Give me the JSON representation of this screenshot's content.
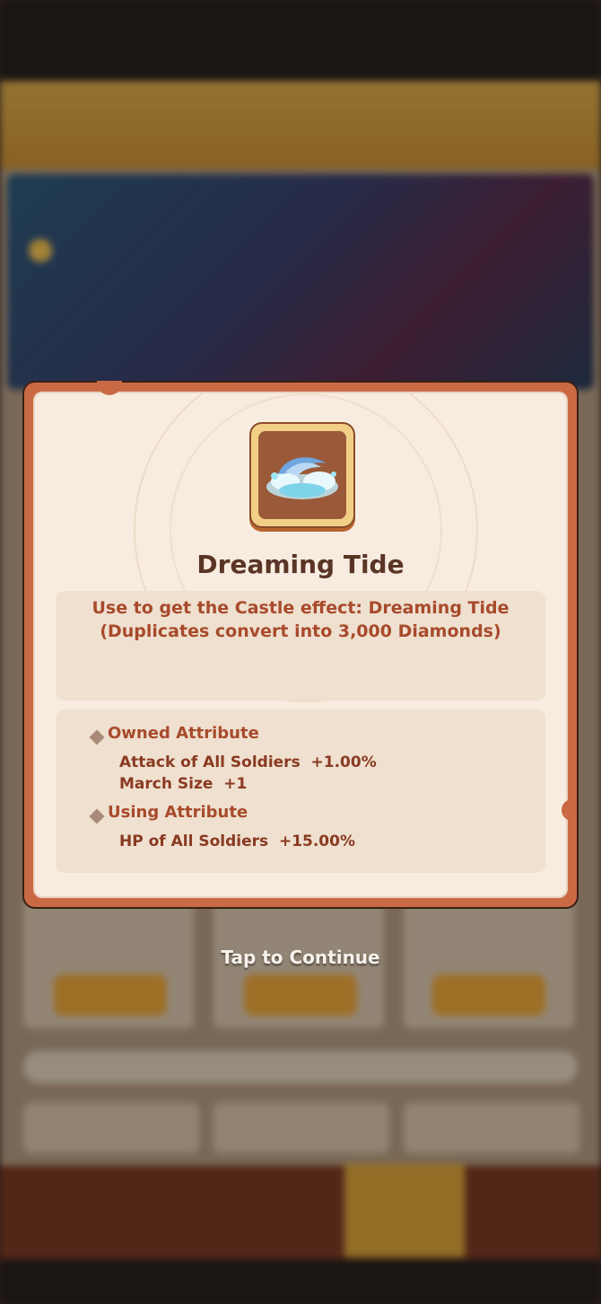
{
  "item": {
    "name": "Dreaming Tide",
    "icon": "wave-cloud-icon",
    "description_line1": "Use to get the Castle effect: Dreaming Tide",
    "description_line2": "(Duplicates convert into 3,000 Diamonds)"
  },
  "attributes": {
    "owned_heading": "Owned Attribute",
    "owned": [
      {
        "text": "Attack of All Soldiers  +1.00%"
      },
      {
        "text": "March Size  +1"
      }
    ],
    "using_heading": "Using Attribute",
    "using": [
      {
        "text": "HP of All Soldiers  +15.00%"
      }
    ]
  },
  "tap_to_continue": "Tap to Continue",
  "colors": {
    "popup_border": "#c96a44",
    "popup_bg": "#f7ecdf",
    "title": "#5a3526",
    "accent_text": "#a84a2c"
  }
}
